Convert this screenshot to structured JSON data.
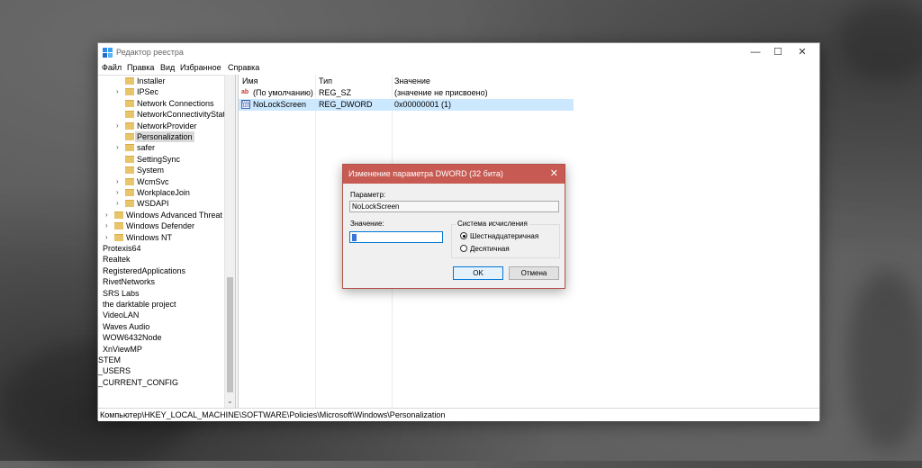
{
  "window": {
    "title": "Редактор реестра",
    "menu": [
      "Файл",
      "Правка",
      "Вид",
      "Избранное",
      "Справка"
    ],
    "controls": {
      "minimize": "—",
      "maximize": "☐",
      "close": "✕"
    }
  },
  "tree": {
    "items": [
      {
        "label": "Installer",
        "expandable": false
      },
      {
        "label": "IPSec",
        "expandable": true
      },
      {
        "label": "Network Connections",
        "expandable": false
      },
      {
        "label": "NetworkConnectivityStatu",
        "expandable": false
      },
      {
        "label": "NetworkProvider",
        "expandable": true
      },
      {
        "label": "Personalization",
        "expandable": false,
        "selected": true
      },
      {
        "label": "safer",
        "expandable": true
      },
      {
        "label": "SettingSync",
        "expandable": false
      },
      {
        "label": "System",
        "expandable": false
      },
      {
        "label": "WcmSvc",
        "expandable": true
      },
      {
        "label": "WorkplaceJoin",
        "expandable": true
      },
      {
        "label": "WSDAPI",
        "expandable": true
      },
      {
        "label": "Windows Advanced Threat Pr",
        "expandable": true
      },
      {
        "label": "Windows Defender",
        "expandable": true
      },
      {
        "label": "Windows NT",
        "expandable": true
      },
      {
        "label": "Protexis64",
        "expandable": false
      },
      {
        "label": "Realtek",
        "expandable": false
      },
      {
        "label": "RegisteredApplications",
        "expandable": false
      },
      {
        "label": "RivetNetworks",
        "expandable": false
      },
      {
        "label": "SRS Labs",
        "expandable": false
      },
      {
        "label": "the darktable project",
        "expandable": false
      },
      {
        "label": "VideoLAN",
        "expandable": false
      },
      {
        "label": "Waves Audio",
        "expandable": false
      },
      {
        "label": "WOW6432Node",
        "expandable": false
      },
      {
        "label": "XnViewMP",
        "expandable": false
      },
      {
        "label": "STEM",
        "expandable": false
      },
      {
        "label": "_USERS",
        "expandable": false
      },
      {
        "label": "_CURRENT_CONFIG",
        "expandable": false
      }
    ]
  },
  "list": {
    "headers": {
      "name": "Имя",
      "type": "Тип",
      "value": "Значение"
    },
    "rows": [
      {
        "icon": "string-value-icon",
        "name": "(По умолчанию)",
        "type": "REG_SZ",
        "value": "(значение не присвоено)"
      },
      {
        "icon": "binary-value-icon",
        "name": "NoLockScreen",
        "type": "REG_DWORD",
        "value": "0x00000001 (1)"
      }
    ]
  },
  "status": {
    "path": "Компьютер\\HKEY_LOCAL_MACHINE\\SOFTWARE\\Policies\\Microsoft\\Windows\\Personalization"
  },
  "dialog": {
    "title": "Изменение параметра DWORD (32 бита)",
    "param_label": "Параметр:",
    "param_value": "NoLockScreen",
    "value_label": "Значение:",
    "value": "1",
    "base_legend": "Система исчисления",
    "radio_hex": "Шестнадцатеричная",
    "radio_dec": "Десятичная",
    "selected_base": "hex",
    "ok": "OK",
    "cancel": "Отмена"
  },
  "colors": {
    "accent": "#0078d7",
    "dialog_title": "#c75a52",
    "selection": "#cce8ff"
  }
}
